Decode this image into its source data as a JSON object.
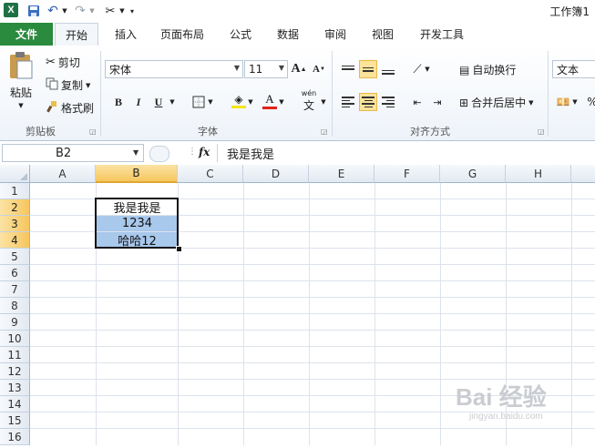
{
  "app": {
    "title": "工作簿1",
    "logo_letter": "X"
  },
  "tabs": [
    {
      "label": "文件"
    },
    {
      "label": "开始"
    },
    {
      "label": "插入"
    },
    {
      "label": "页面布局"
    },
    {
      "label": "公式"
    },
    {
      "label": "数据"
    },
    {
      "label": "审阅"
    },
    {
      "label": "视图"
    },
    {
      "label": "开发工具"
    }
  ],
  "ribbon": {
    "clipboard": {
      "paste": "粘贴",
      "cut": "剪切",
      "copy": "复制",
      "format_painter": "格式刷",
      "group_label": "剪贴板"
    },
    "font": {
      "font_name": "宋体",
      "font_size": "11",
      "bold": "B",
      "italic": "I",
      "underline": "U",
      "group_label": "字体",
      "phonetic": "wén"
    },
    "alignment": {
      "wrap_text": "自动换行",
      "merge_center": "合并后居中",
      "group_label": "对齐方式"
    },
    "number": {
      "format": "文本"
    }
  },
  "formula_bar": {
    "name_box": "B2",
    "fx": "fx",
    "content": "我是我是"
  },
  "grid": {
    "columns": [
      "A",
      "B",
      "C",
      "D",
      "E",
      "F",
      "G",
      "H"
    ],
    "rows": [
      "1",
      "2",
      "3",
      "4",
      "5",
      "6",
      "7",
      "8",
      "9",
      "10",
      "11",
      "12",
      "13",
      "14",
      "15",
      "16"
    ],
    "selected_column": "B",
    "cells": {
      "B2": "我是我是",
      "B3": "1234",
      "B4": "哈哈12"
    }
  },
  "watermark": {
    "text": "Bai 经验",
    "sub": "jingyan.baidu.com"
  },
  "colors": {
    "file_tab": "#2a8a3e",
    "selection_fill": "#a8c8ec",
    "header_selected": "#f6c65e"
  }
}
